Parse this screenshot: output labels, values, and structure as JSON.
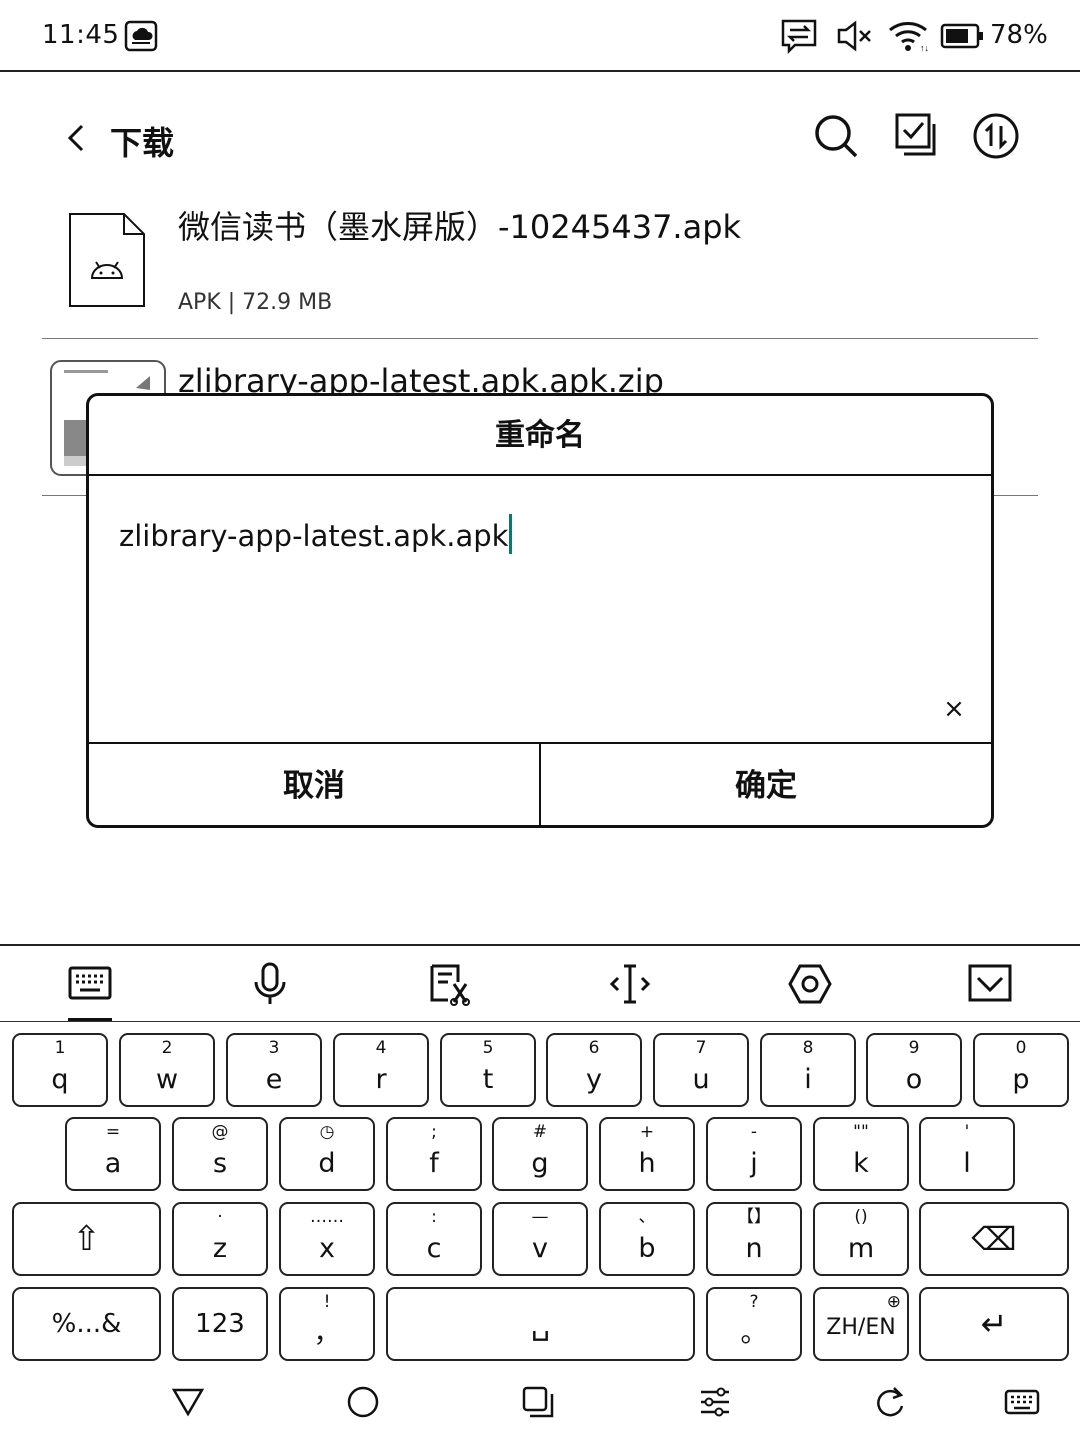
{
  "status_bar": {
    "time": "11:45",
    "battery_percent": "78%",
    "icons": [
      "cloud-sync-icon",
      "data-transfer-icon",
      "mute-icon",
      "wifi-icon",
      "battery-icon"
    ]
  },
  "header": {
    "title": "下载",
    "actions": [
      "search-icon",
      "multi-select-icon",
      "sort-icon"
    ]
  },
  "files": [
    {
      "name": "微信读书（墨水屏版）-10245437.apk",
      "meta": "APK | 72.9 MB",
      "icon": "android-apk-icon"
    },
    {
      "name": "zlibrary-app-latest.apk.apk.zip",
      "meta": "",
      "icon": "zip-thumbnail-icon"
    }
  ],
  "dialog": {
    "title": "重命名",
    "input_value": "zlibrary-app-latest.apk.apk",
    "clear_icon": "×",
    "cancel_label": "取消",
    "confirm_label": "确定"
  },
  "keyboard": {
    "toolbar": [
      "keyboard-icon",
      "microphone-icon",
      "edit-clipboard-icon",
      "cursor-move-icon",
      "settings-hexagon-icon",
      "hide-keyboard-icon"
    ],
    "row1": [
      {
        "sub": "1",
        "main": "q"
      },
      {
        "sub": "2",
        "main": "w"
      },
      {
        "sub": "3",
        "main": "e"
      },
      {
        "sub": "4",
        "main": "r"
      },
      {
        "sub": "5",
        "main": "t"
      },
      {
        "sub": "6",
        "main": "y"
      },
      {
        "sub": "7",
        "main": "u"
      },
      {
        "sub": "8",
        "main": "i"
      },
      {
        "sub": "9",
        "main": "o"
      },
      {
        "sub": "0",
        "main": "p"
      }
    ],
    "row2": [
      {
        "sub": "=",
        "main": "a"
      },
      {
        "sub": "@",
        "main": "s"
      },
      {
        "sub": "◷",
        "main": "d"
      },
      {
        "sub": ";",
        "main": "f"
      },
      {
        "sub": "#",
        "main": "g"
      },
      {
        "sub": "+",
        "main": "h"
      },
      {
        "sub": "-",
        "main": "j"
      },
      {
        "sub": "\"\"",
        "main": "k"
      },
      {
        "sub": "'",
        "main": "l"
      }
    ],
    "row3": [
      {
        "sub": "·",
        "main": "z"
      },
      {
        "sub": "……",
        "main": "x"
      },
      {
        "sub": ":",
        "main": "c"
      },
      {
        "sub": "—",
        "main": "v"
      },
      {
        "sub": "、",
        "main": "b"
      },
      {
        "sub": "【】",
        "main": "n"
      },
      {
        "sub": "()",
        "main": "m"
      }
    ],
    "shift_symbol": "⇧",
    "backspace_symbol": "⌫",
    "symbols_label": "%...&",
    "numbers_label": "123",
    "comma_sub": "!",
    "comma_main": "，",
    "space_symbol": "␣",
    "period_sub": "?",
    "period_main": "。",
    "lang_label": "ZH/EN",
    "lang_sub": "⊕",
    "enter_symbol": "↵"
  },
  "nav_bar": [
    "back-triangle-icon",
    "home-circle-icon",
    "recents-square-icon",
    "adjust-sliders-icon",
    "refresh-icon",
    "keyboard-toggle-icon"
  ]
}
